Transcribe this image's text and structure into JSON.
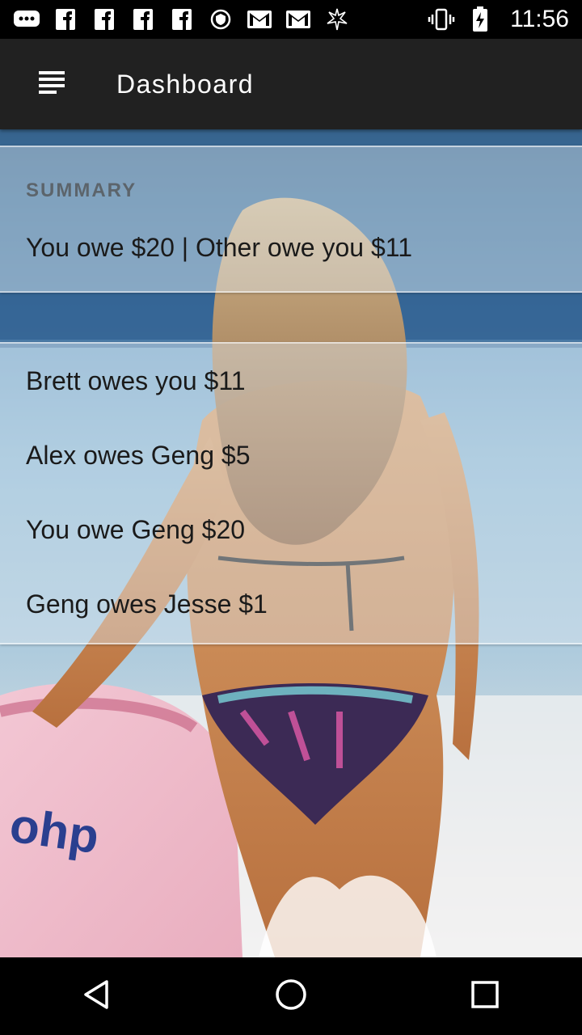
{
  "status_bar": {
    "time": "11:56",
    "left_icons": [
      "chat-icon",
      "facebook-icon",
      "facebook-icon",
      "facebook-icon",
      "facebook-icon",
      "vpn-shield-icon",
      "gmail-icon",
      "gmail-icon",
      "app-logo-icon"
    ],
    "right_icons": [
      "vibrate-icon",
      "battery-charging-icon"
    ]
  },
  "app_bar": {
    "title": "Dashboard",
    "menu_icon": "menu-icon"
  },
  "summary": {
    "header": "SUMMARY",
    "text": "You owe $20 | Other owe you $11"
  },
  "debts": [
    {
      "text": "Brett owes you $11"
    },
    {
      "text": "Alex owes Geng $5"
    },
    {
      "text": "You owe Geng $20"
    },
    {
      "text": "Geng owes Jesse $1"
    }
  ],
  "nav_bar": {
    "buttons": [
      "back-icon",
      "home-icon",
      "recents-icon"
    ]
  },
  "colors": {
    "app_bar": "#212121",
    "status_bar": "#000000",
    "nav_bar": "#000000",
    "text_primary": "#1a1a1a",
    "header_text": "#505050"
  }
}
